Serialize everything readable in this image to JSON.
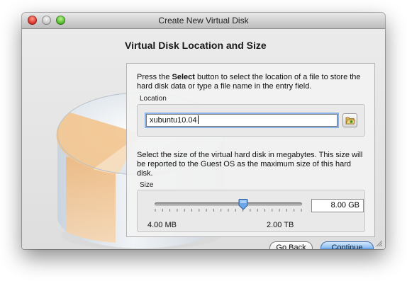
{
  "window": {
    "title": "Create New Virtual Disk"
  },
  "page": {
    "heading": "Virtual Disk Location and Size"
  },
  "location": {
    "description_prefix": "Press the ",
    "description_bold": "Select",
    "description_suffix": " button to select the location of a file to store the hard disk data or type a file name in the entry field.",
    "label": "Location",
    "value": "xubuntu10.04",
    "folder_button_icon": "folder-open-icon"
  },
  "size": {
    "description": "Select the size of the virtual hard disk in megabytes. This size will be reported to the Guest OS as the maximum size of this hard disk.",
    "label": "Size",
    "value": "8.00 GB",
    "min_label": "4.00 MB",
    "max_label": "2.00 TB",
    "slider_fraction": 0.6
  },
  "buttons": {
    "back": "Go Back",
    "continue": "Continue"
  },
  "colors": {
    "accent": "#5b9ae3",
    "close": "#d8322a",
    "zoom": "#52b82c"
  }
}
